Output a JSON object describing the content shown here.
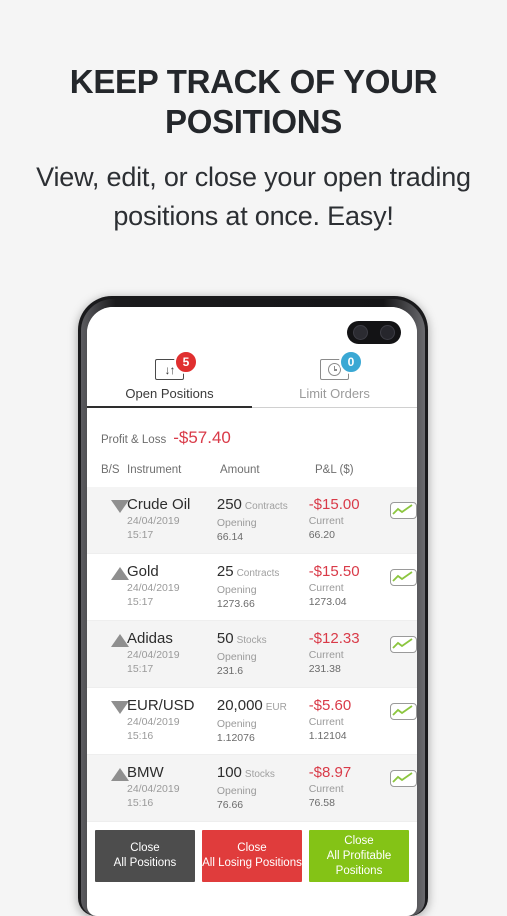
{
  "promo": {
    "title": "KEEP TRACK OF YOUR POSITIONS",
    "subtitle": "View, edit, or close your open trading positions at once. Easy!"
  },
  "app": {
    "tabs": [
      {
        "label": "Open Positions",
        "badge": "5",
        "badge_color": "#e02f2f",
        "icon": "up-down-arrows-icon",
        "active": true
      },
      {
        "label": "Limit Orders",
        "badge": "0",
        "badge_color": "#3aa8d4",
        "icon": "clock-icon",
        "active": false
      }
    ],
    "summary": {
      "label": "Profit & Loss",
      "value": "-$57.40",
      "value_color": "#d93a48"
    },
    "table": {
      "headers": {
        "bs": "B/S",
        "instrument": "Instrument",
        "amount": "Amount",
        "pl": "P&L ($)"
      },
      "opening_label": "Opening",
      "current_label": "Current",
      "rows": [
        {
          "direction": "down",
          "instrument": "Crude Oil",
          "date": "24/04/2019",
          "time": "15:17",
          "amount": "250",
          "unit": "Contracts",
          "opening": "66.14",
          "current": "66.20",
          "pl": "-$15.00"
        },
        {
          "direction": "up",
          "instrument": "Gold",
          "date": "24/04/2019",
          "time": "15:17",
          "amount": "25",
          "unit": "Contracts",
          "opening": "1273.66",
          "current": "1273.04",
          "pl": "-$15.50"
        },
        {
          "direction": "up",
          "instrument": "Adidas",
          "date": "24/04/2019",
          "time": "15:17",
          "amount": "50",
          "unit": "Stocks",
          "opening": "231.6",
          "current": "231.38",
          "pl": "-$12.33"
        },
        {
          "direction": "down",
          "instrument": "EUR/USD",
          "date": "24/04/2019",
          "time": "15:16",
          "amount": "20,000",
          "unit": "EUR",
          "opening": "1.12076",
          "current": "1.12104",
          "pl": "-$5.60"
        },
        {
          "direction": "up",
          "instrument": "BMW",
          "date": "24/04/2019",
          "time": "15:16",
          "amount": "100",
          "unit": "Stocks",
          "opening": "76.66",
          "current": "76.58",
          "pl": "-$8.97"
        }
      ]
    },
    "buttons": [
      {
        "line1": "Close",
        "line2": "All Positions",
        "color": "#4d4d4d"
      },
      {
        "line1": "Close",
        "line2": "All Losing Positions",
        "color": "#e03c3c"
      },
      {
        "line1": "Close",
        "line2": "All Profitable Positions",
        "color": "#84c316"
      }
    ]
  }
}
